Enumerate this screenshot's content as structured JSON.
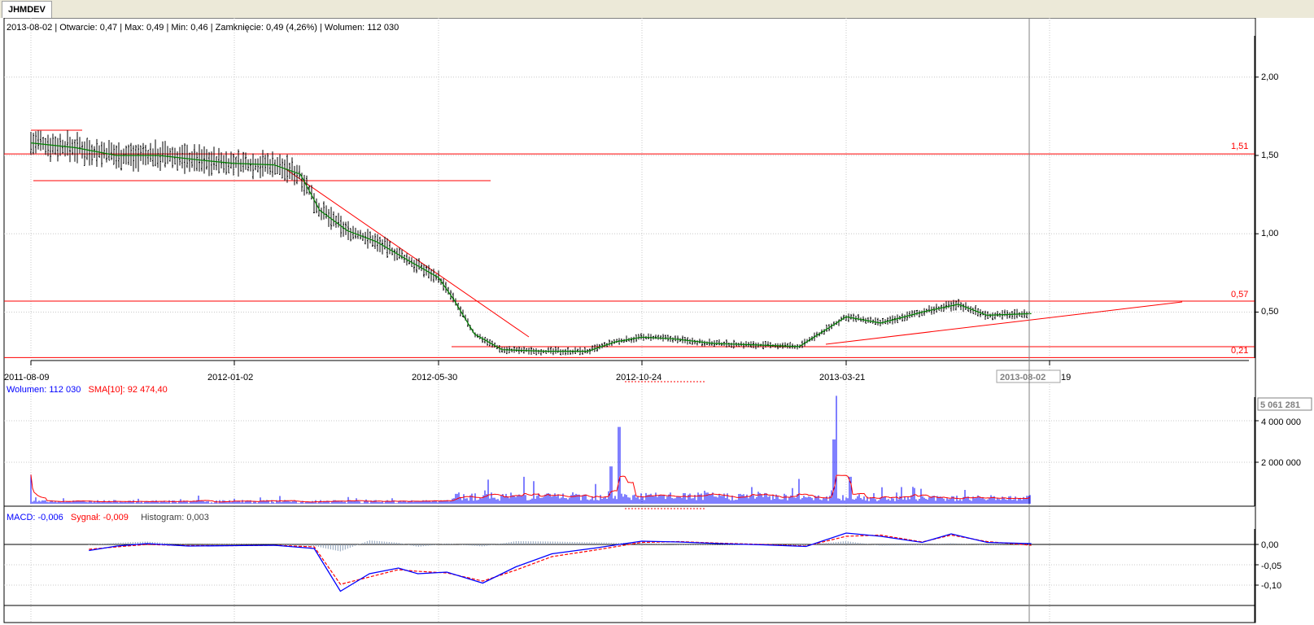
{
  "tab": {
    "label": "JHMDEV"
  },
  "price_info": "2013-08-02 | Otwarcie: 0,47 | Max: 0,49 | Min: 0,46 | Zamknięcie: 0,49 (4,26%)  | Wolumen: 112 030",
  "volume_info": {
    "label": "Wolumen: 112 030",
    "sma_label": "SMA[10]: 92 474,40"
  },
  "macd_info": {
    "macd_label": "MACD: -0,006",
    "signal_label": "Sygnał: -0,009",
    "hist_label": "Histogram: 0,003"
  },
  "colors": {
    "candle": "#000000",
    "sma": "#008000",
    "line": "#ff0000",
    "volume": "#0000ff",
    "macd": "#0000ff",
    "signal": "#ff0000",
    "histogram": "#8c9fb8",
    "grid": "#c8c8c8"
  },
  "chart_data": [
    {
      "type": "candlestick",
      "title": "JHMDEV",
      "x_tick_labels": [
        "2011-08-09",
        "2012-01-02",
        "2012-05-30",
        "2012-10-24",
        "2013-03-21"
      ],
      "crosshair_date": "2013-08-02",
      "y_ticks": [
        "0,50",
        "1,00",
        "1,50",
        "2,00"
      ],
      "ylim": [
        0.2,
        2.25
      ],
      "level_labels": [
        "1,51",
        "0,57",
        "0,21"
      ],
      "horizontal_levels": [
        1.51,
        0.57,
        0.21
      ],
      "sma_points": [
        [
          "2011-08-09",
          1.58
        ],
        [
          "2011-09-10",
          1.55
        ],
        [
          "2011-10-10",
          1.5
        ],
        [
          "2011-11-10",
          1.5
        ],
        [
          "2011-12-10",
          1.47
        ],
        [
          "2012-01-02",
          1.45
        ],
        [
          "2012-02-01",
          1.44
        ],
        [
          "2012-02-20",
          1.38
        ],
        [
          "2012-03-05",
          1.15
        ],
        [
          "2012-03-25",
          1.02
        ],
        [
          "2012-04-15",
          0.95
        ],
        [
          "2012-05-10",
          0.82
        ],
        [
          "2012-05-30",
          0.72
        ],
        [
          "2012-06-10",
          0.58
        ],
        [
          "2012-06-25",
          0.36
        ],
        [
          "2012-07-15",
          0.26
        ],
        [
          "2012-08-15",
          0.25
        ],
        [
          "2012-09-15",
          0.25
        ],
        [
          "2012-10-05",
          0.31
        ],
        [
          "2012-10-24",
          0.34
        ],
        [
          "2012-11-15",
          0.33
        ],
        [
          "2012-12-15",
          0.3
        ],
        [
          "2013-01-15",
          0.29
        ],
        [
          "2013-02-15",
          0.28
        ],
        [
          "2013-03-21",
          0.47
        ],
        [
          "2013-04-15",
          0.43
        ],
        [
          "2013-05-15",
          0.5
        ],
        [
          "2013-06-10",
          0.55
        ],
        [
          "2013-07-01",
          0.48
        ],
        [
          "2013-08-02",
          0.49
        ]
      ],
      "series": [
        {
          "name": "Max",
          "values": [
            1.55,
            1.66,
            1.55,
            1.52,
            1.5,
            1.48,
            1.45,
            1.39,
            1.25,
            1.06,
            1.0,
            0.94,
            0.85,
            0.72,
            0.58,
            0.35,
            0.3,
            0.29,
            0.27,
            0.38,
            0.42,
            0.36,
            0.35,
            0.33,
            0.31,
            0.29,
            0.56,
            0.47,
            0.51,
            0.59,
            0.52,
            0.49
          ]
        },
        {
          "name": "Min",
          "values": [
            1.42,
            1.48,
            1.31,
            1.47,
            1.45,
            1.31,
            1.32,
            1.36,
            1.1,
            0.88,
            0.92,
            0.83,
            0.72,
            0.55,
            0.36,
            0.21,
            0.2,
            0.21,
            0.21,
            0.29,
            0.3,
            0.29,
            0.29,
            0.27,
            0.26,
            0.26,
            0.39,
            0.4,
            0.44,
            0.47,
            0.43,
            0.46
          ]
        }
      ]
    },
    {
      "type": "bar",
      "title": "Wolumen",
      "y_ticks": [
        "2 000 000",
        "4 000 000"
      ],
      "current_value_label": "5 061 281",
      "ylim": [
        0,
        5500000
      ],
      "spikes": [
        [
          "2011-08-09",
          1400000
        ],
        [
          "2012-10-08",
          3700000
        ],
        [
          "2012-10-02",
          1800000
        ],
        [
          "2013-03-14",
          5200000
        ],
        [
          "2013-03-12",
          3100000
        ],
        [
          "2012-07-31",
          1300000
        ],
        [
          "2013-03-24",
          1300000
        ]
      ]
    },
    {
      "type": "line",
      "title": "MACD",
      "y_ticks": [
        "0,00",
        "-0,05",
        "-0,10"
      ],
      "ylim": [
        -0.125,
        0.045
      ],
      "x": [
        "2011-09-20",
        "2011-10-10",
        "2011-11-01",
        "2011-12-01",
        "2012-01-02",
        "2012-02-01",
        "2012-03-01",
        "2012-03-20",
        "2012-04-10",
        "2012-05-01",
        "2012-05-15",
        "2012-06-05",
        "2012-07-01",
        "2012-07-25",
        "2012-08-20",
        "2012-09-20",
        "2012-10-24",
        "2012-11-20",
        "2012-12-20",
        "2013-01-20",
        "2013-02-20",
        "2013-03-21",
        "2013-04-15",
        "2013-05-15",
        "2013-06-05",
        "2013-07-01",
        "2013-08-02"
      ],
      "series": [
        {
          "name": "MACD",
          "values": [
            -0.015,
            -0.004,
            0.002,
            -0.004,
            -0.003,
            -0.002,
            -0.01,
            -0.115,
            -0.072,
            -0.058,
            -0.072,
            -0.068,
            -0.095,
            -0.055,
            -0.023,
            -0.009,
            0.008,
            0.006,
            0.002,
            -0.001,
            -0.005,
            0.028,
            0.02,
            0.005,
            0.026,
            0.005,
            0.002
          ]
        },
        {
          "name": "Sygnał",
          "values": [
            -0.012,
            -0.006,
            0.0,
            -0.003,
            -0.003,
            -0.002,
            -0.006,
            -0.098,
            -0.08,
            -0.062,
            -0.066,
            -0.07,
            -0.09,
            -0.063,
            -0.03,
            -0.014,
            0.005,
            0.007,
            0.003,
            0.0,
            -0.004,
            0.02,
            0.023,
            0.006,
            0.023,
            0.007,
            -0.002
          ]
        },
        {
          "name": "Histogram",
          "values": [
            -0.001,
            0.004,
            0.007,
            0.0,
            0.001,
            0.0,
            -0.004,
            -0.017,
            0.01,
            0.004,
            -0.006,
            0.002,
            -0.005,
            0.008,
            0.007,
            0.005,
            0.003,
            -0.001,
            -0.001,
            -0.001,
            -0.001,
            0.008,
            -0.003,
            -0.001,
            0.003,
            -0.002,
            0.003
          ]
        }
      ]
    }
  ]
}
